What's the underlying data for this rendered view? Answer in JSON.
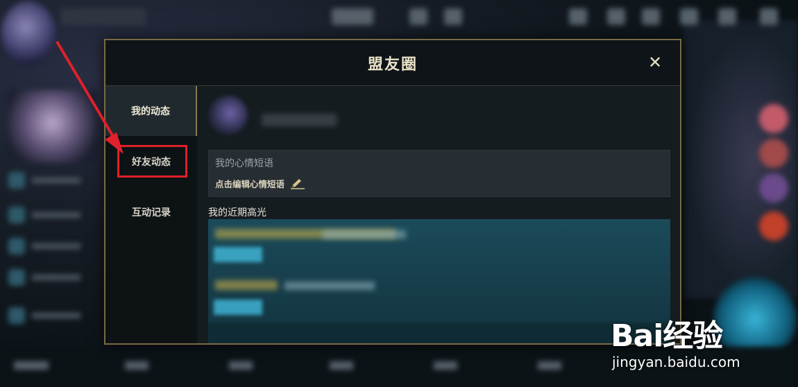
{
  "modal": {
    "title": "盟友圈",
    "close_label": "✕"
  },
  "sidebar": {
    "tabs": [
      {
        "label": "我的动态",
        "active": true
      },
      {
        "label": "好友动态",
        "active": false,
        "highlighted": true
      },
      {
        "label": "互动记录",
        "active": false
      }
    ]
  },
  "content": {
    "mood": {
      "label": "我的心情短语",
      "edit_label": "点击编辑心情短语"
    },
    "highlights_title": "我的近期高光"
  },
  "watermark": {
    "brand": "Bai经验",
    "url": "jingyan.baidu.com"
  },
  "colors": {
    "modal_border": "#7a6a45",
    "annotation_red": "#e0202a",
    "highlight_teal": "#1b4b5a"
  }
}
